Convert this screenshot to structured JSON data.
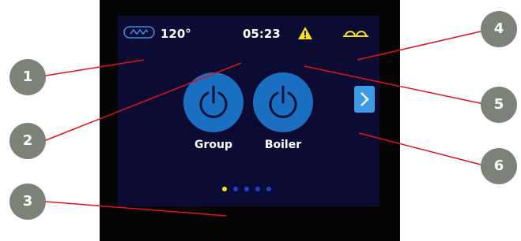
{
  "status_bar": {
    "temperature": "120°",
    "time": "05:23",
    "wave_icon": "steam-wave-icon",
    "warning_icon": "warning-triangle-icon",
    "cups_icon": "cups-icon"
  },
  "buttons": [
    {
      "label": "Group",
      "icon": "power-icon"
    },
    {
      "label": "Boiler",
      "icon": "power-icon"
    }
  ],
  "next_icon": "chevron-right-icon",
  "page_indicator": {
    "total": 5,
    "active_index": 0
  },
  "callouts": [
    "1",
    "2",
    "3",
    "4",
    "5",
    "6"
  ],
  "colors": {
    "screen_bg": "#0b0b33",
    "button": "#1b6fc0",
    "accent_yellow": "#f5e21a",
    "dot_inactive": "#1e3fd8",
    "line": "#e0141b",
    "callout": "#7d8278"
  }
}
